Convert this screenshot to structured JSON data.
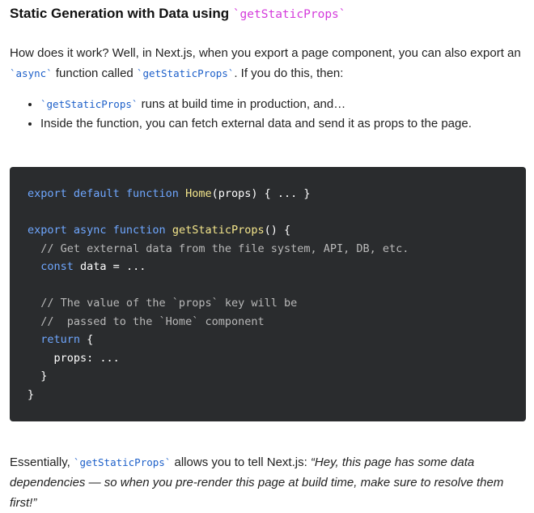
{
  "heading": {
    "text": "Static Generation with Data using ",
    "code": "`getStaticProps`"
  },
  "intro": {
    "part1": "How does it work? Well, in Next.js, when you export a page component, you can also export an ",
    "code1": "`async`",
    "part2": " function called ",
    "code2": "`getStaticProps`",
    "part3": ". If you do this, then:"
  },
  "bullets": [
    {
      "code": "`getStaticProps`",
      "text": " runs at build time in production, and…"
    },
    {
      "code": "",
      "text": "Inside the function, you can fetch external data and send it as props to the page."
    }
  ],
  "code_lines": [
    [
      {
        "t": "export default function ",
        "c": "kw"
      },
      {
        "t": "Home",
        "c": "fn"
      },
      {
        "t": "(props) { ... }",
        "c": "tx"
      }
    ],
    [],
    [
      {
        "t": "export async function ",
        "c": "kw"
      },
      {
        "t": "getStaticProps",
        "c": "fn"
      },
      {
        "t": "() {",
        "c": "tx"
      }
    ],
    [
      {
        "t": "  // Get external data from the file system, API, DB, etc.",
        "c": "cm"
      }
    ],
    [
      {
        "t": "  ",
        "c": "tx"
      },
      {
        "t": "const ",
        "c": "kw"
      },
      {
        "t": "data = ...",
        "c": "tx"
      }
    ],
    [],
    [
      {
        "t": "  // The value of the `props` key will be",
        "c": "cm"
      }
    ],
    [
      {
        "t": "  //  passed to the `Home` component",
        "c": "cm"
      }
    ],
    [
      {
        "t": "  ",
        "c": "tx"
      },
      {
        "t": "return ",
        "c": "kw"
      },
      {
        "t": "{",
        "c": "tx"
      }
    ],
    [
      {
        "t": "    props: ...",
        "c": "tx"
      }
    ],
    [
      {
        "t": "  }",
        "c": "tx"
      }
    ],
    [
      {
        "t": "}",
        "c": "tx"
      }
    ]
  ],
  "outro": {
    "part1": "Essentially, ",
    "code": "`getStaticProps`",
    "part2": " allows you to tell Next.js: ",
    "quote": "“Hey, this page has some data dependencies — so when you pre-render this page at build time, make sure to resolve them first!”"
  },
  "colors": {
    "code_bg": "#2a2c2e",
    "keyword": "#6fa7ff",
    "function": "#f3e58b",
    "comment": "#b9b9b9",
    "inline_code": "#1c5fc9",
    "heading_code": "#d43adb"
  }
}
